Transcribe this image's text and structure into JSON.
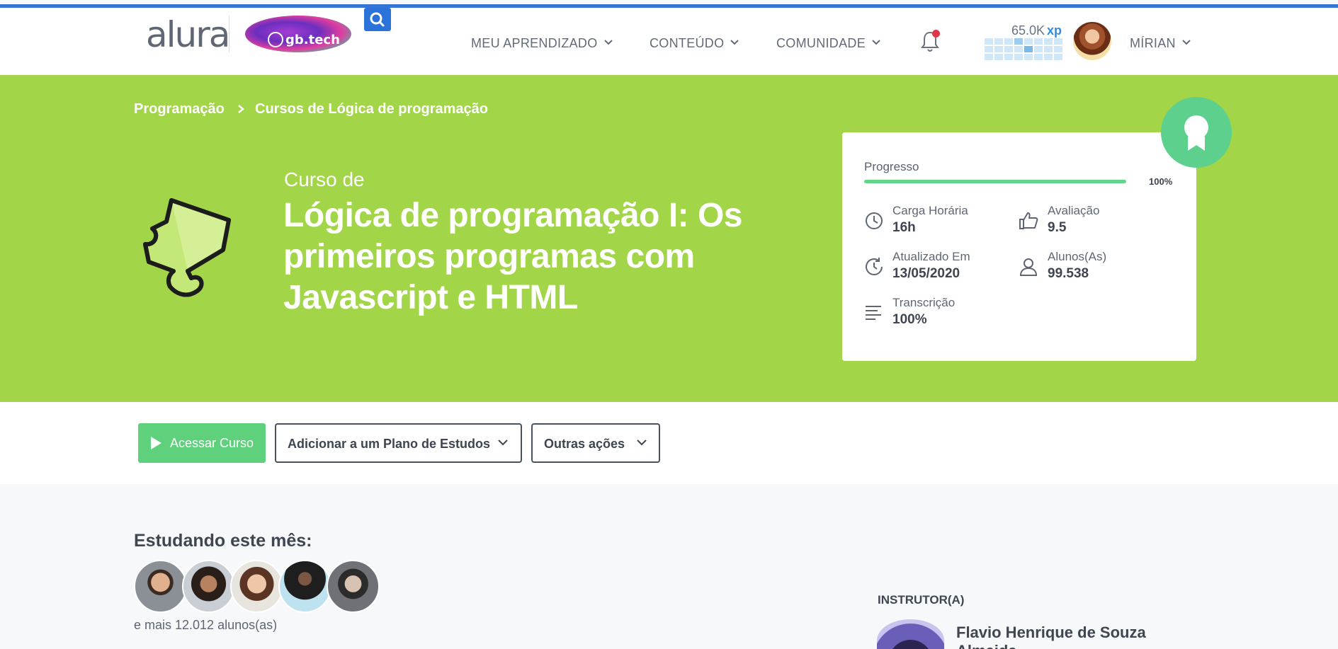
{
  "header": {
    "logo": "alura",
    "partner_logo": "gb.tech",
    "nav": [
      {
        "label": "MEU APRENDIZADO"
      },
      {
        "label": "CONTEÚDO"
      },
      {
        "label": "COMUNIDADE"
      }
    ],
    "xp_value": "65.0K",
    "xp_unit": "xp",
    "user_name": "MÍRIAN",
    "icons": {
      "search": "search-icon",
      "notifications": "bell-icon",
      "dropdown": "chevron-down-icon"
    },
    "colors": {
      "top_line": "#3474d6",
      "search_bg": "#2c73d9",
      "notification_dot": "#e0364b",
      "xp_accent": "#2f8ce0"
    }
  },
  "hero": {
    "breadcrumb": [
      "Programação",
      "Cursos de Lógica de programação"
    ],
    "course_prefix": "Curso de",
    "course_title": "Lógica de programação I: Os primeiros programas com Javascript e HTML",
    "background": "#a2d548",
    "progress": {
      "label": "Progresso",
      "value": 1.0,
      "percent_text": "100%",
      "bar_color": "#62d58a"
    },
    "stats": [
      {
        "icon": "clock-icon",
        "label": "Carga Horária",
        "value": "16h"
      },
      {
        "icon": "thumbs-up-icon",
        "label": "Avaliação",
        "value": "9.5"
      },
      {
        "icon": "history-icon",
        "label": "Atualizado Em",
        "value": "13/05/2020"
      },
      {
        "icon": "user-icon",
        "label": "Alunos(As)",
        "value": "99.538"
      },
      {
        "icon": "text-lines-icon",
        "label": "Transcrição",
        "value": "100%"
      }
    ]
  },
  "actions": {
    "access": "Acessar Curso",
    "add_plan": "Adicionar a um Plano de Estudos",
    "other": "Outras ações",
    "access_color": "#5fd17c"
  },
  "community": {
    "heading": "Estudando este mês:",
    "more_students": "e mais 12.012 alunos(as)",
    "instructor_label": "INSTRUTOR(A)",
    "instructor_name": "Flavio Henrique de Souza Almeida"
  }
}
